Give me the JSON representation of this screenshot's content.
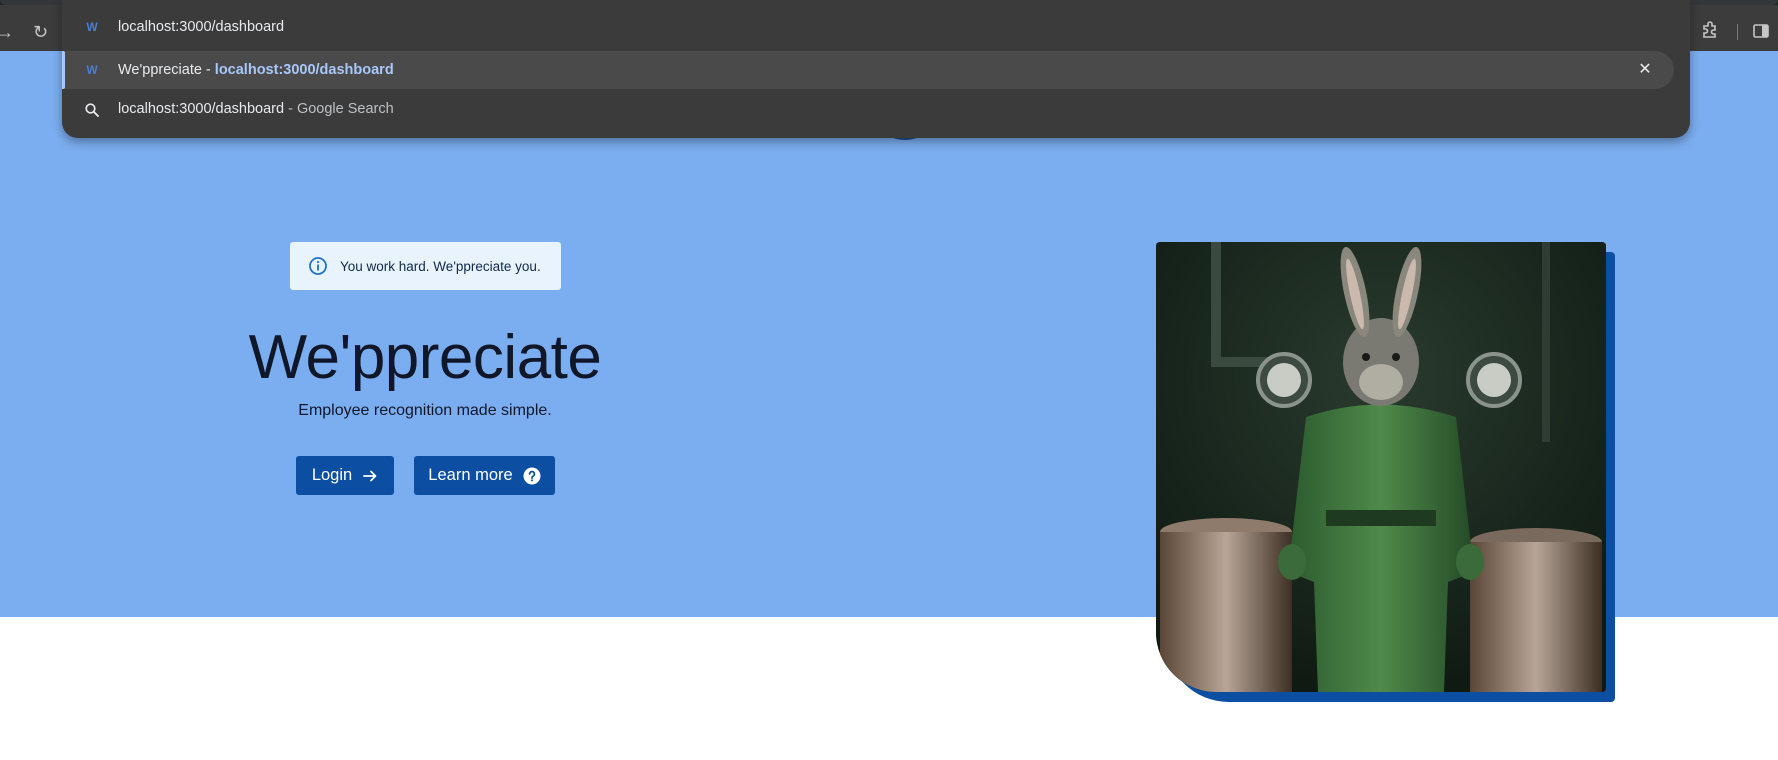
{
  "browser": {
    "address_text": "localhost:3000/dashboard",
    "address_host": "localhost",
    "address_rest": ":3000/dashboard",
    "favicon_letter": "W",
    "suggestions": [
      {
        "title": "We'ppreciate",
        "separator": " - ",
        "url": "localhost:3000/dashboard",
        "icon": "site-favicon",
        "close_icon": "✕"
      },
      {
        "query": "localhost:3000/dashboard",
        "suffix": " - Google Search",
        "icon": "search-icon"
      }
    ],
    "icons": {
      "forward": "→",
      "reload": "↻"
    }
  },
  "hero": {
    "alert_text": "You work hard. We'ppreciate you.",
    "title": "We'ppreciate",
    "subtitle": "Employee recognition made simple.",
    "login_label": "Login",
    "learn_more_label": "Learn more",
    "image_icon": "rabbit-mechanic-image"
  },
  "colors": {
    "hero_bg": "#7baef0",
    "primary": "#0b4ea2",
    "alert_bg": "#e9f3fe",
    "chrome_bg": "#3c3c3c",
    "omnibox_highlight": "#a8c7fa"
  }
}
